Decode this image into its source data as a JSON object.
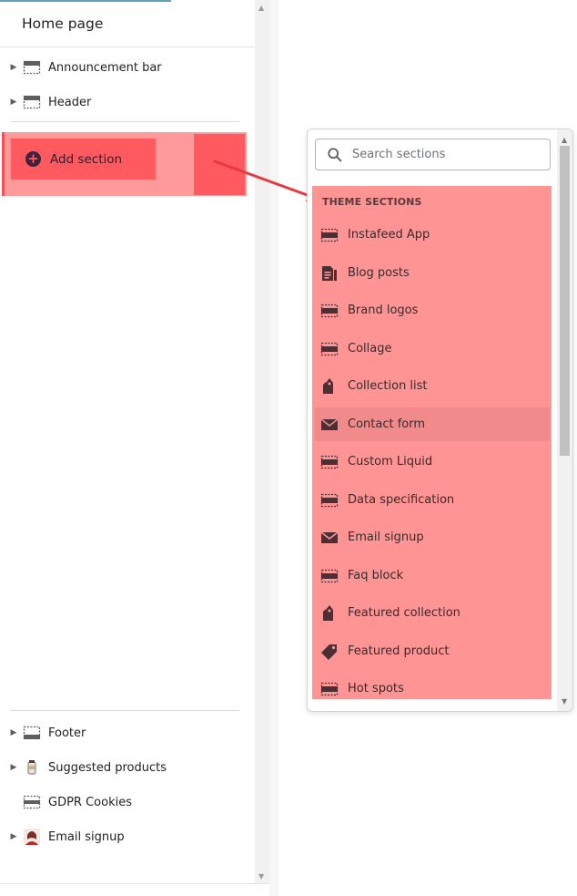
{
  "sidebar": {
    "title": "Home page",
    "top_items": [
      {
        "label": "Announcement bar",
        "icon": "section-template-icon"
      },
      {
        "label": "Header",
        "icon": "section-template-icon"
      }
    ],
    "add_section_label": "Add section",
    "bottom_items": [
      {
        "label": "Footer",
        "icon": "section-template-icon"
      },
      {
        "label": "Suggested products",
        "icon": "product-thumbnail-icon"
      },
      {
        "label": "GDPR Cookies",
        "icon": "section-template-icon"
      },
      {
        "label": "Email signup",
        "icon": "person-thumbnail-icon"
      }
    ]
  },
  "popup": {
    "search_placeholder": "Search sections",
    "group_title": "THEME SECTIONS",
    "items": [
      {
        "label": "Instafeed App",
        "icon": "section-template-icon"
      },
      {
        "label": "Blog posts",
        "icon": "blog-icon"
      },
      {
        "label": "Brand logos",
        "icon": "section-template-icon"
      },
      {
        "label": "Collage",
        "icon": "section-template-icon"
      },
      {
        "label": "Collection list",
        "icon": "collection-tag-icon"
      },
      {
        "label": "Contact form",
        "icon": "envelope-icon"
      },
      {
        "label": "Custom Liquid",
        "icon": "section-template-icon"
      },
      {
        "label": "Data specification",
        "icon": "section-template-icon"
      },
      {
        "label": "Email signup",
        "icon": "envelope-icon"
      },
      {
        "label": "Faq block",
        "icon": "section-template-icon"
      },
      {
        "label": "Featured collection",
        "icon": "collection-tag-icon"
      },
      {
        "label": "Featured product",
        "icon": "price-tag-icon"
      },
      {
        "label": "Hot spots",
        "icon": "section-template-icon"
      }
    ],
    "highlight_color": "#ff9494",
    "accent_color": "#ff5a5f",
    "arrow_color": "#e8393f"
  }
}
